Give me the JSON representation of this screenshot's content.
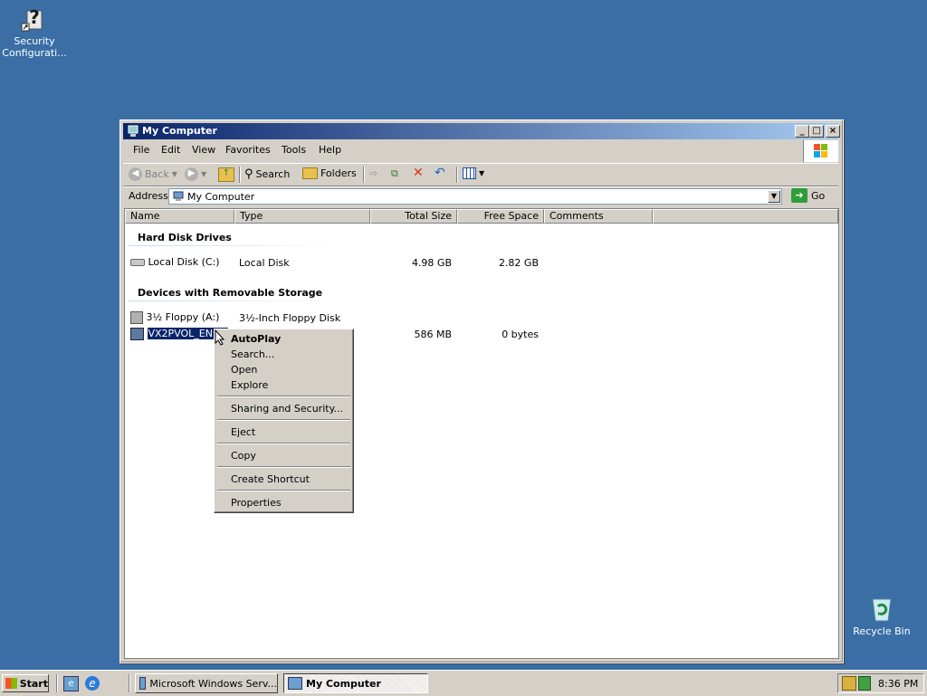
{
  "desktop": {
    "icons": [
      {
        "label": "Security Configurati...",
        "icon": "security-config-icon"
      },
      {
        "label": "Recycle Bin",
        "icon": "recycle-bin-icon"
      }
    ],
    "background_color": "#3a6ea5"
  },
  "window": {
    "title": "My Computer",
    "menu": [
      "File",
      "Edit",
      "View",
      "Favorites",
      "Tools",
      "Help"
    ],
    "toolbar": {
      "back": "Back",
      "search": "Search",
      "folders": "Folders"
    },
    "address": {
      "label": "Address",
      "value": "My Computer",
      "go": "Go"
    },
    "columns": [
      "Name",
      "Type",
      "Total Size",
      "Free Space",
      "Comments"
    ],
    "groups": [
      {
        "title": "Hard Disk Drives",
        "items": [
          {
            "name": "Local Disk (C:)",
            "type": "Local Disk",
            "total": "4.98 GB",
            "free": "2.82 GB"
          }
        ]
      },
      {
        "title": "Devices with Removable Storage",
        "items": [
          {
            "name": "3½ Floppy (A:)",
            "type": "3½-Inch Floppy Disk",
            "total": "",
            "free": ""
          },
          {
            "name": "VX2PVOL_EN (D",
            "type": "",
            "total": "586 MB",
            "free": "0 bytes"
          }
        ]
      }
    ]
  },
  "context_menu": {
    "items": [
      "AutoPlay",
      "Search...",
      "Open",
      "Explore",
      "Sharing and Security...",
      "Eject",
      "Copy",
      "Create Shortcut",
      "Properties"
    ]
  },
  "taskbar": {
    "start": "Start",
    "tasks": [
      "Microsoft Windows Serv...",
      "My Computer"
    ],
    "clock": "8:36 PM"
  }
}
